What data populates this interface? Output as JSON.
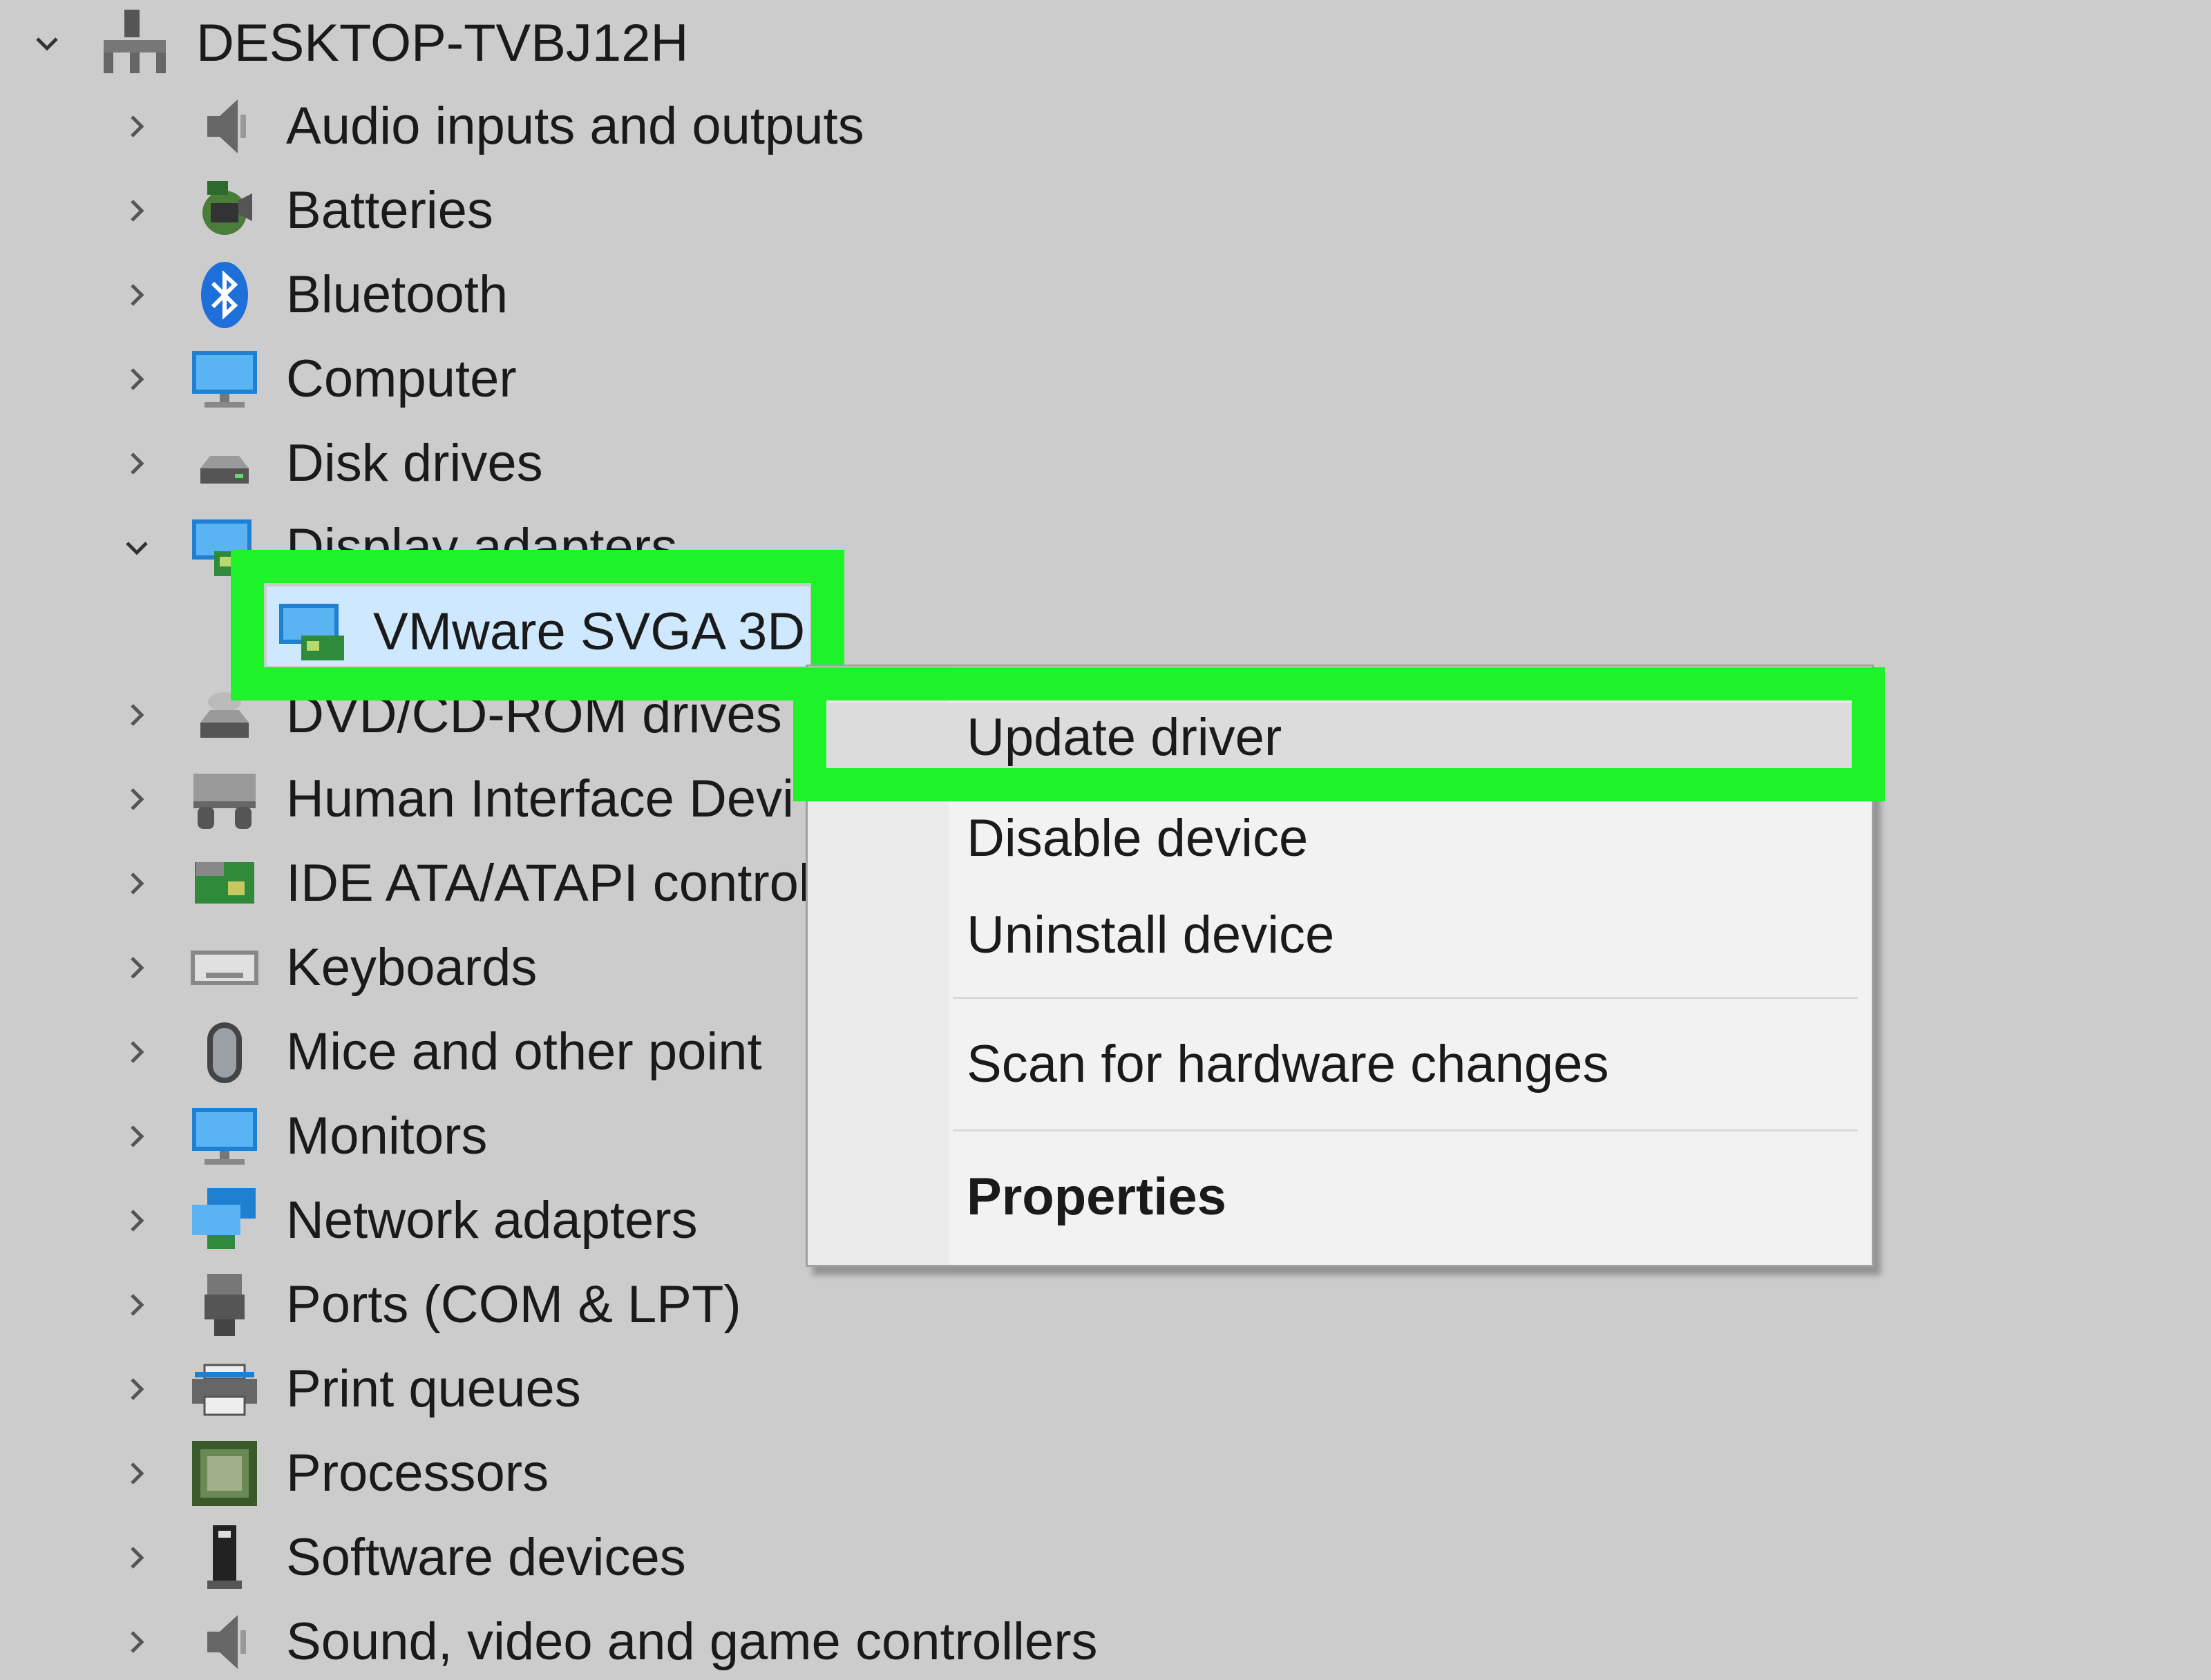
{
  "root": {
    "label": "DESKTOP-TVBJ12H",
    "icon": "computer-network-icon",
    "expanded": true
  },
  "categories": [
    {
      "label": "Audio inputs and outputs",
      "icon": "speaker-icon"
    },
    {
      "label": "Batteries",
      "icon": "battery-icon"
    },
    {
      "label": "Bluetooth",
      "icon": "bluetooth-icon"
    },
    {
      "label": "Computer",
      "icon": "monitor-icon"
    },
    {
      "label": "Disk drives",
      "icon": "disk-drive-icon"
    },
    {
      "label": "Display adapters",
      "icon": "display-adapter-icon",
      "expanded": true
    },
    {
      "label": "VMware SVGA 3D",
      "icon": "display-adapter-icon",
      "child": true,
      "selected": true
    },
    {
      "label": "DVD/CD-ROM drives",
      "icon": "dvd-drive-icon"
    },
    {
      "label": "Human Interface Devi",
      "icon": "hid-icon"
    },
    {
      "label": "IDE ATA/ATAPI controll",
      "icon": "ide-controller-icon"
    },
    {
      "label": "Keyboards",
      "icon": "keyboard-icon"
    },
    {
      "label": "Mice and other point",
      "icon": "mouse-icon"
    },
    {
      "label": "Monitors",
      "icon": "monitor-icon"
    },
    {
      "label": "Network adapters",
      "icon": "network-adapter-icon"
    },
    {
      "label": "Ports (COM & LPT)",
      "icon": "port-icon"
    },
    {
      "label": "Print queues",
      "icon": "printer-icon"
    },
    {
      "label": "Processors",
      "icon": "processor-icon"
    },
    {
      "label": "Software devices",
      "icon": "software-device-icon"
    },
    {
      "label": "Sound, video and game controllers",
      "icon": "speaker-icon"
    }
  ],
  "context_menu": {
    "items": [
      {
        "label": "Update driver",
        "highlighted": true
      },
      {
        "label": "Disable device"
      },
      {
        "label": "Uninstall device"
      },
      {
        "label": "Scan for hardware changes"
      },
      {
        "label": "Properties",
        "bold": true
      }
    ]
  },
  "colors": {
    "background": "#cccccc",
    "highlight_box": "#1ef32a",
    "selection": "#cde8ff",
    "menu_background": "#f2f2f2"
  }
}
